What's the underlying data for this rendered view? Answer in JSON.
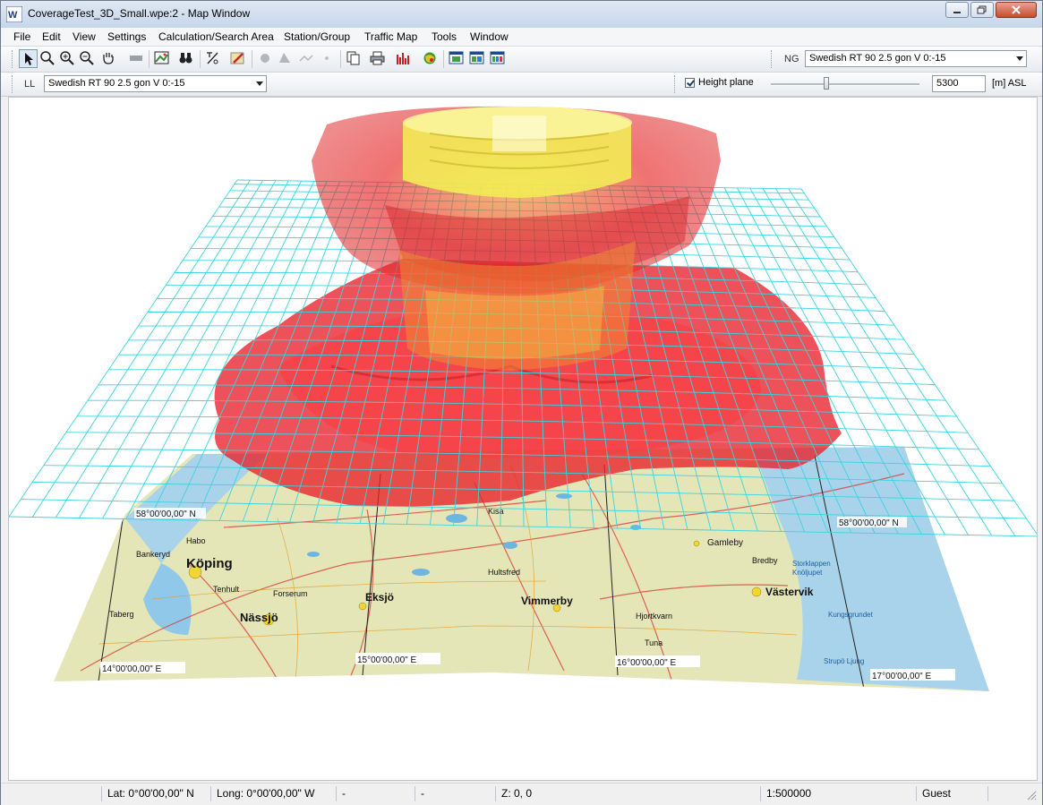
{
  "window": {
    "title": "CoverageTest_3D_Small.wpe:2 - Map Window"
  },
  "menu": [
    "File",
    "Edit",
    "View",
    "Settings",
    "Calculation/Search Area",
    "Station/Group",
    "Traffic Map",
    "Tools",
    "Window"
  ],
  "toolbar": {
    "ng_label": "NG",
    "ng_value": "Swedish RT 90 2.5 gon V 0:-15"
  },
  "toolbar2": {
    "ll_label": "LL",
    "ll_value": "Swedish RT 90 2.5 gon V 0:-15",
    "height_plane_label": "Height plane",
    "height_plane_checked": true,
    "height_value": "5300",
    "height_unit": "[m] ASL"
  },
  "map": {
    "labels": {
      "lat_58": "58°00'00,00\" N",
      "lat_58_right": "58°00'00,00\" N",
      "lon_14": "14°00'00,00\" E",
      "lon_15": "15°00'00,00\" E",
      "lon_16": "16°00'00,00\" E",
      "lon_17": "17°00'00,00\" E"
    },
    "places": [
      "Köping",
      "Nässjö",
      "Eksjö",
      "Vimmerby",
      "Västervik",
      "Gamleby",
      "Tenhult",
      "Forserum",
      "Taberg",
      "Bankeryd",
      "Habo",
      "Hjortkvarn",
      "Tuna",
      "Bredby",
      "Kisa",
      "Hultsfred",
      "Storklappen",
      "Knöljupet",
      "Kungsgrundet",
      "Strupö Ljung"
    ]
  },
  "status": {
    "lat": "Lat: 0°00'00,00\" N",
    "long": "Long: 0°00'00,00\" W",
    "c3": "-",
    "c4": "-",
    "z": "Z: 0, 0",
    "scale": "1:500000",
    "user": "Guest"
  },
  "colors": {
    "grid": "#39d4e0",
    "coverage_red": "#e8202a",
    "coverage_yellow": "#f2ee55",
    "map_land": "#e4e6b8",
    "map_water": "#a9d3ea"
  }
}
